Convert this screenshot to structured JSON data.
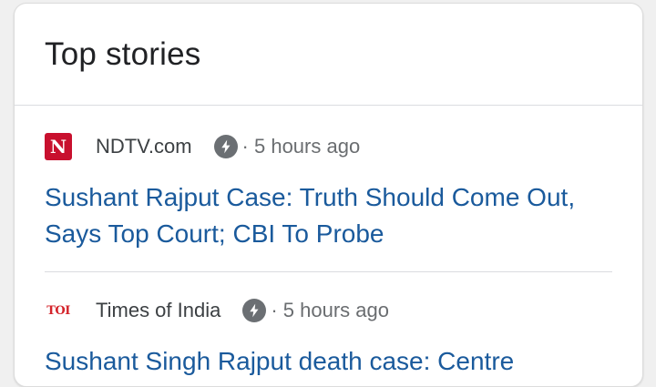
{
  "top_stories": {
    "title": "Top stories",
    "stories": [
      {
        "source": "NDTV.com",
        "logo_text": "N",
        "logo_icon": "ndtv-logo",
        "amp_icon": "lightning-bolt-icon",
        "time": "· 5 hours ago",
        "headline": "Sushant Rajput Case: Truth Should Come Out, Says Top Court; CBI To Probe"
      },
      {
        "source": "Times of India",
        "logo_text": "TOI",
        "logo_icon": "toi-logo",
        "amp_icon": "lightning-bolt-icon",
        "time": "· 5 hours ago",
        "headline": "Sushant Singh Rajput death case: Centre"
      }
    ]
  },
  "colors": {
    "headline_link": "#1a5a9c",
    "ndtv_red": "#c8102e",
    "toi_red": "#d4242b",
    "amp_badge": "#6b6f73"
  }
}
